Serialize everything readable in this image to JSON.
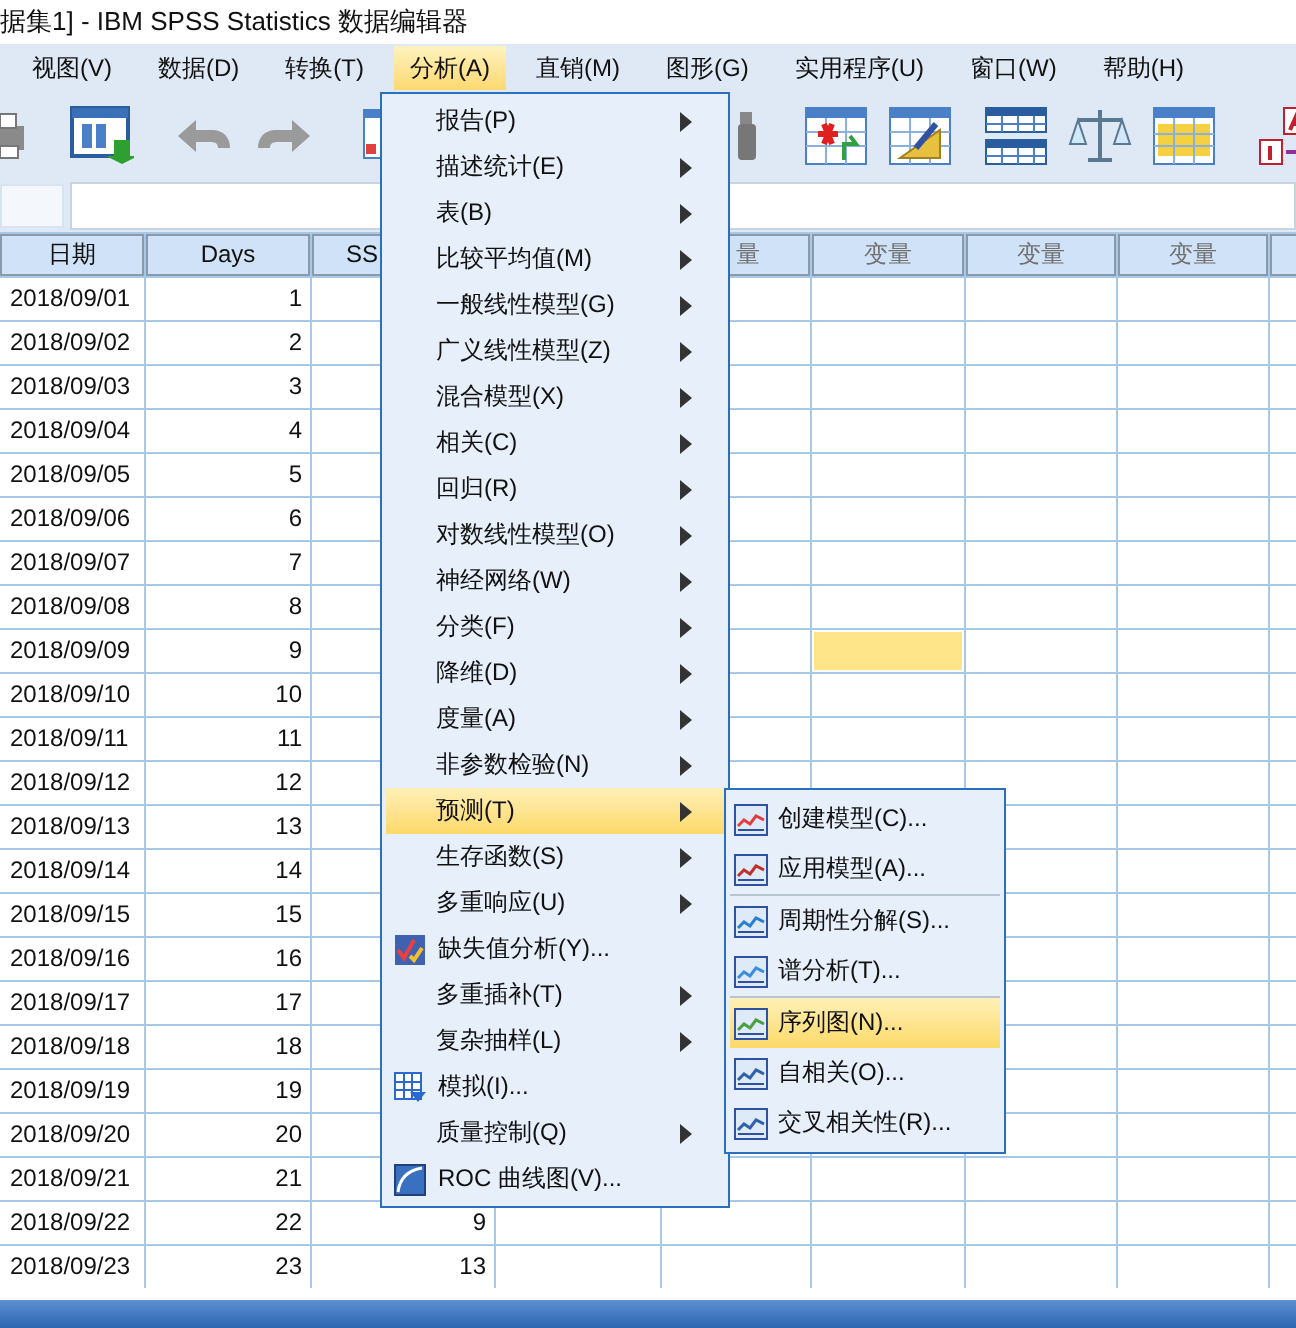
{
  "window": {
    "title": "据集1] - IBM SPSS Statistics 数据编辑器"
  },
  "menu_bar": [
    {
      "label": "视图(V)",
      "selected": false
    },
    {
      "label": "数据(D)",
      "selected": false
    },
    {
      "label": "转换(T)",
      "selected": false
    },
    {
      "label": "分析(A)",
      "selected": true
    },
    {
      "label": "直销(M)",
      "selected": false
    },
    {
      "label": "图形(G)",
      "selected": false
    },
    {
      "label": "实用程序(U)",
      "selected": false
    },
    {
      "label": "窗口(W)",
      "selected": false
    },
    {
      "label": "帮助(H)",
      "selected": false
    }
  ],
  "table": {
    "columns": [
      {
        "label": "日期",
        "kind": "defined"
      },
      {
        "label": "Days",
        "kind": "defined"
      },
      {
        "label": "SS",
        "kind": "defined"
      },
      {
        "kind": "empty"
      },
      {
        "label": "量",
        "kind": "empty"
      },
      {
        "label": "变量",
        "kind": "empty"
      },
      {
        "label": "变量",
        "kind": "empty"
      },
      {
        "label": "变量",
        "kind": "empty"
      }
    ],
    "rows": [
      {
        "date": "2018/09/01",
        "days": "1",
        "selected": false
      },
      {
        "date": "2018/09/02",
        "days": "2",
        "selected": false
      },
      {
        "date": "2018/09/03",
        "days": "3",
        "selected": false
      },
      {
        "date": "2018/09/04",
        "days": "4",
        "selected": false
      },
      {
        "date": "2018/09/05",
        "days": "5",
        "selected": false
      },
      {
        "date": "2018/09/06",
        "days": "6",
        "selected": false
      },
      {
        "date": "2018/09/07",
        "days": "7",
        "selected": false
      },
      {
        "date": "2018/09/08",
        "days": "8",
        "selected": false
      },
      {
        "date": "2018/09/09",
        "days": "9",
        "selected": true
      },
      {
        "date": "2018/09/10",
        "days": "10",
        "selected": false
      },
      {
        "date": "2018/09/11",
        "days": "11",
        "selected": false
      },
      {
        "date": "2018/09/12",
        "days": "12",
        "selected": false
      },
      {
        "date": "2018/09/13",
        "days": "13"
      },
      {
        "date": "2018/09/14",
        "days": "14"
      },
      {
        "date": "2018/09/15",
        "days": "15"
      },
      {
        "date": "2018/09/16",
        "days": "16"
      },
      {
        "date": "2018/09/17",
        "days": "17"
      },
      {
        "date": "2018/09/18",
        "days": "18"
      },
      {
        "date": "2018/09/19",
        "days": "19"
      },
      {
        "date": "2018/09/20",
        "days": "20",
        "selected": false
      },
      {
        "date": "2018/09/21",
        "days": "21",
        "selected": false
      },
      {
        "date": "2018/09/22",
        "days": "22",
        "column_3": "9",
        "selected": false
      },
      {
        "date": "2018/09/23",
        "days": "23",
        "column_3": "13",
        "selected": false
      }
    ]
  },
  "analyze_menu": [
    {
      "label": "报告(P)",
      "kind": "submenu",
      "selected": false
    },
    {
      "label": "描述统计(E)",
      "kind": "submenu",
      "selected": false
    },
    {
      "label": "表(B)",
      "kind": "submenu",
      "selected": false
    },
    {
      "label": "比较平均值(M)",
      "kind": "submenu",
      "selected": false
    },
    {
      "label": "一般线性模型(G)",
      "kind": "submenu",
      "selected": false
    },
    {
      "label": "广义线性模型(Z)",
      "kind": "submenu",
      "selected": false
    },
    {
      "label": "混合模型(X)",
      "kind": "submenu",
      "selected": false
    },
    {
      "label": "相关(C)",
      "kind": "submenu",
      "selected": false
    },
    {
      "label": "回归(R)",
      "kind": "submenu",
      "selected": false
    },
    {
      "label": "对数线性模型(O)",
      "kind": "submenu",
      "selected": false
    },
    {
      "label": "神经网络(W)",
      "kind": "submenu",
      "selected": false
    },
    {
      "label": "分类(F)",
      "kind": "submenu",
      "selected": false
    },
    {
      "label": "降维(D)",
      "kind": "submenu",
      "selected": false
    },
    {
      "label": "度量(A)",
      "kind": "submenu",
      "selected": false
    },
    {
      "label": "非参数检验(N)",
      "kind": "submenu",
      "selected": false
    },
    {
      "label": "预测(T)",
      "kind": "submenu",
      "selected": true
    },
    {
      "label": "生存函数(S)",
      "kind": "submenu",
      "selected": false
    },
    {
      "label": "多重响应(U)",
      "kind": "submenu",
      "selected": false
    },
    {
      "label": "缺失值分析(Y)...",
      "kind": "missing",
      "selected": false
    },
    {
      "label": "多重插补(T)",
      "kind": "submenu",
      "selected": false
    },
    {
      "label": "复杂抽样(L)",
      "kind": "submenu",
      "selected": false
    },
    {
      "label": "模拟(I)...",
      "kind": "simulation",
      "selected": false
    },
    {
      "label": "质量控制(Q)",
      "kind": "submenu",
      "selected": false
    },
    {
      "label": "ROC 曲线图(V)...",
      "kind": "roc",
      "selected": false
    }
  ],
  "forecast_menu": [
    {
      "label": "创建模型(C)...",
      "divider_above": false,
      "selected": false
    },
    {
      "label": "应用模型(A)...",
      "divider_above": false,
      "selected": false
    },
    {
      "label": "周期性分解(S)...",
      "divider_above": true,
      "selected": false
    },
    {
      "label": "谱分析(T)...",
      "divider_above": false,
      "selected": false
    },
    {
      "label": "序列图(N)...",
      "divider_above": true,
      "selected": true
    },
    {
      "label": "自相关(O)...",
      "divider_above": false,
      "selected": false
    },
    {
      "label": "交叉相关性(R)...",
      "divider_above": false,
      "selected": false
    }
  ]
}
